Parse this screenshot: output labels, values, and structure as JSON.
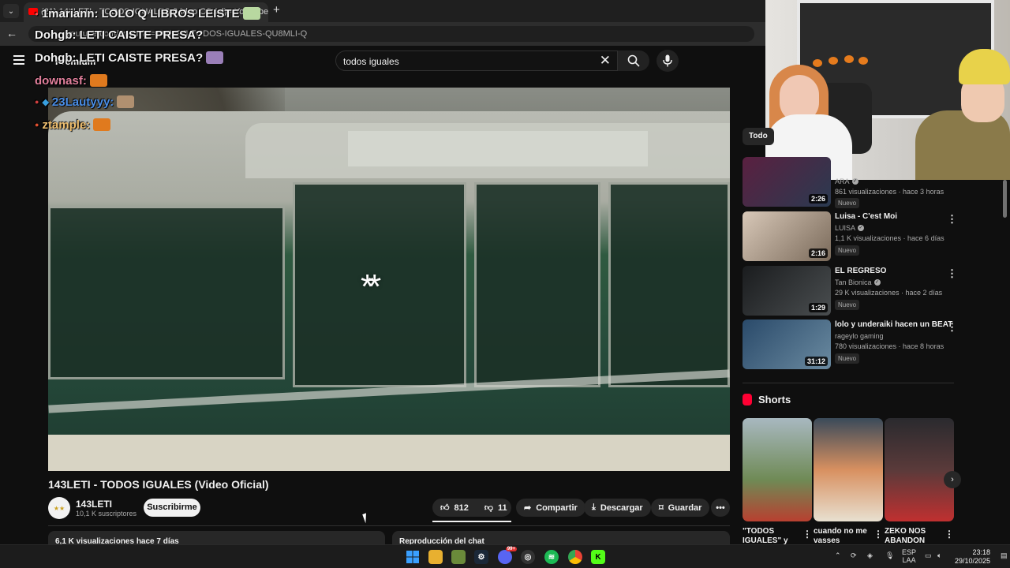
{
  "browser": {
    "tab_title": "(21) 143LETI - TODOS IGUALES (Video Oficial) - YouTube and Music",
    "new_tab_symbol": "+",
    "url": "youtube.com/watch?v=143LETI-TODOS-IGUALES-QU8MLI-Q"
  },
  "youtube": {
    "premium_label": "Premium",
    "search_value": "todos iguales",
    "video_title": "143LETI - TODOS IGUALES (Video Oficial)",
    "channel_name": "143LETI",
    "channel_subs": "10,1 K suscriptores",
    "subscribe_label": "Suscribirme",
    "likes": "812",
    "dislikes": "11",
    "share_label": "Compartir",
    "download_label": "Descargar",
    "save_label": "Guardar",
    "description_stub": "6,1 K visualizaciones  hace 7 días",
    "chat_replay_stub": "Reproducción del chat",
    "video_overlay_logo": "**"
  },
  "chat": [
    {
      "user": "1mariann:",
      "message": "LOLO Q LIBROS LEISTE",
      "color": "#ffffff"
    },
    {
      "user": "Dohgb:",
      "message": "LETI CAISTE PRESA?",
      "color": "#ffffff"
    },
    {
      "user": "Dohgb:",
      "message": "LETI CAISTE PRESA?",
      "color": "#ffffff"
    },
    {
      "user": "downasf:",
      "message": "",
      "color": "#e07f9b"
    },
    {
      "user": "23Lautyyy:",
      "message": "",
      "color": "#4a8ee6"
    },
    {
      "user": "ztample:",
      "message": "",
      "color": "#f0c070"
    }
  ],
  "sidebar": {
    "chip_label": "Todo",
    "recommendations": [
      {
        "title": "",
        "channel": "ARA",
        "meta": "861 visualizaciones · hace 3 horas",
        "badge": "Nuevo",
        "duration": "2:26",
        "thumb_color": "#3a2030"
      },
      {
        "title": "Luisa - C'est Moi",
        "channel": "LUISA",
        "meta": "1,1 K visualizaciones · hace 6 días",
        "badge": "Nuevo",
        "duration": "2:16",
        "thumb_color": "#b9a89a"
      },
      {
        "title": "EL REGRESO",
        "channel": "Tan Bionica",
        "meta": "29 K visualizaciones · hace 2 días",
        "badge": "Nuevo",
        "duration": "1:29",
        "thumb_color": "#2b2e30"
      },
      {
        "title": "lolo y underaiki hacen un BEAT",
        "channel": "rageylo gaming",
        "meta": "780 visualizaciones · hace 8 horas",
        "badge": "Nuevo",
        "duration": "31:12",
        "thumb_color": "#30455a"
      }
    ],
    "shorts_title": "Shorts",
    "shorts": [
      {
        "title": "\"TODOS IGUALES\" y",
        "thumb_color": "#6f8a55"
      },
      {
        "title": "cuando no me vasses",
        "thumb_color": "#5a6b7d"
      },
      {
        "title": "ZEKO NOS ABANDON",
        "thumb_color": "#3a3034"
      }
    ]
  },
  "taskbar": {
    "lang": "ESP",
    "lang2": "LAA",
    "time": "23:18",
    "date": "29/10/2025",
    "discord_badge": "99+"
  }
}
